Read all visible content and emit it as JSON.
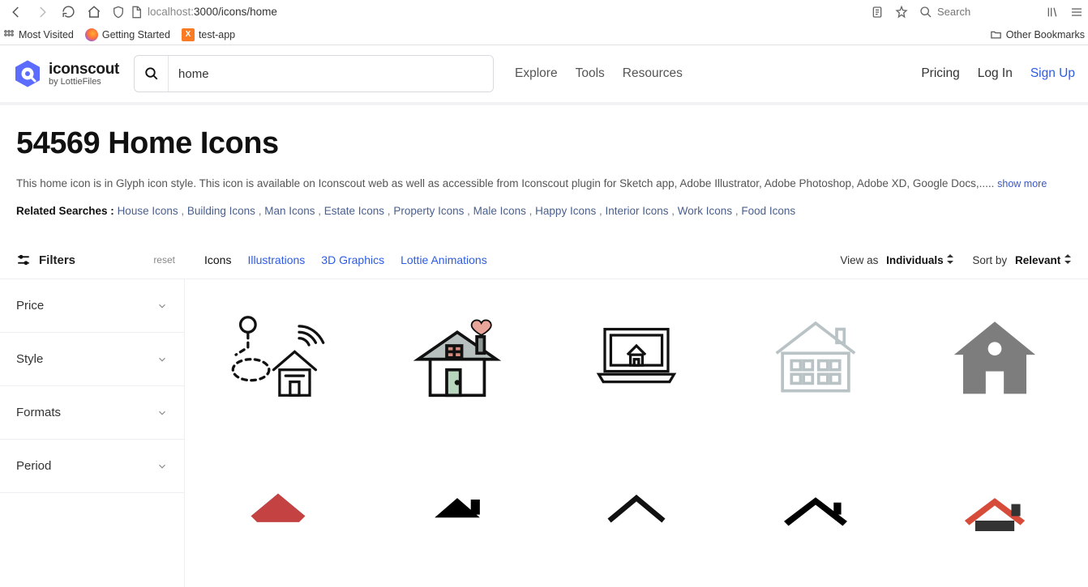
{
  "browser": {
    "url_host": "localhost:",
    "url_rest": "3000/icons/home",
    "search_placeholder": "Search",
    "other_bookmarks": "Other Bookmarks",
    "bookmarks": [
      "Most Visited",
      "Getting Started",
      "test-app"
    ]
  },
  "header": {
    "brand": "iconscout",
    "brand_by": "by LottieFiles",
    "search_value": "home",
    "nav": [
      "Explore",
      "Tools",
      "Resources"
    ],
    "pricing": "Pricing",
    "login": "Log In",
    "signup": "Sign Up"
  },
  "page": {
    "title": "54569 Home Icons",
    "desc": "This home icon is in Glyph icon style. This icon is available on Iconscout web as well as accessible from Iconscout plugin for Sketch app, Adobe Illustrator, Adobe Photoshop, Adobe XD, Google Docs,..... ",
    "show_more": "show more",
    "related_label": "Related Searches : ",
    "related": [
      "House Icons",
      "Building Icons",
      "Man Icons",
      "Estate Icons",
      "Property Icons",
      "Male Icons",
      "Happy Icons",
      "Interior Icons",
      "Work Icons",
      "Food Icons"
    ]
  },
  "controls": {
    "filters": "Filters",
    "reset": "reset",
    "tabs": [
      "Icons",
      "Illustrations",
      "3D Graphics",
      "Lottie Animations"
    ],
    "view_as_label": "View as",
    "view_as_value": "Individuals",
    "sort_by_label": "Sort by",
    "sort_by_value": "Relevant"
  },
  "sidebar": {
    "items": [
      "Price",
      "Style",
      "Formats",
      "Period"
    ]
  },
  "icons_row1": [
    "smart-home-person",
    "house-heart",
    "laptop-home",
    "house-outline-windows",
    "home-solid-gray"
  ],
  "icons_row2": [
    "roof-diamond",
    "house-black-chimney",
    "roof-outline",
    "house-black-sharp",
    "house-red-roof"
  ]
}
